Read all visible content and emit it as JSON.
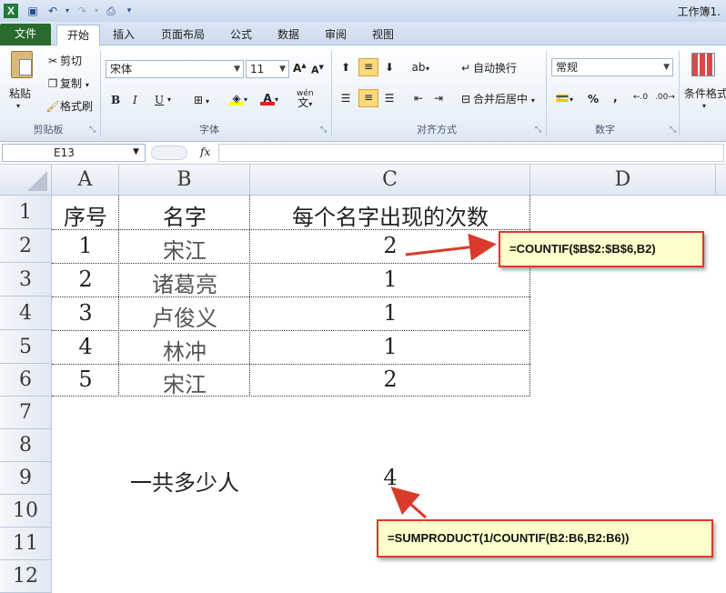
{
  "window": {
    "title": "工作簿1."
  },
  "quick_access": {
    "icons": [
      "excel-icon",
      "save-icon",
      "undo-icon",
      "redo-icon",
      "print-preview-icon",
      "customize-icon"
    ]
  },
  "tabs": [
    "文件",
    "开始",
    "插入",
    "页面布局",
    "公式",
    "数据",
    "审阅",
    "视图"
  ],
  "ribbon": {
    "clipboard": {
      "paste": "粘贴",
      "cut": "剪切",
      "copy": "复制",
      "format_painter": "格式刷",
      "label": "剪贴板"
    },
    "font": {
      "name": "宋体",
      "size": "11",
      "bold": "B",
      "italic": "I",
      "underline": "U",
      "label": "字体",
      "phonetic": "wén"
    },
    "alignment": {
      "wrap": "自动换行",
      "merge": "合并后居中",
      "label": "对齐方式"
    },
    "number": {
      "format": "常规",
      "percent": "%",
      "comma": ",",
      "label": "数字"
    },
    "styles": {
      "conditional": "条件格式"
    }
  },
  "formula_bar": {
    "name_box": "E13",
    "fx": "fx",
    "value": ""
  },
  "columns": [
    "A",
    "B",
    "C",
    "D"
  ],
  "rows": [
    "1",
    "2",
    "3",
    "4",
    "5",
    "6",
    "7",
    "8",
    "9",
    "10",
    "11",
    "12"
  ],
  "table": {
    "header": [
      "序号",
      "名字",
      "每个名字出现的次数"
    ],
    "rows": [
      [
        "1",
        "宋江",
        "2"
      ],
      [
        "2",
        "诸葛亮",
        "1"
      ],
      [
        "3",
        "卢俊义",
        "1"
      ],
      [
        "4",
        "林冲",
        "1"
      ],
      [
        "5",
        "宋江",
        "2"
      ]
    ]
  },
  "total": {
    "label": "一共多少人",
    "value": "4"
  },
  "annotations": {
    "countif": "=COUNTIF($B$2:$B$6,B2)",
    "sumproduct": "=SUMPRODUCT(1/COUNTIF(B2:B6,B2:B6))",
    "arrow_color": "#d93a2b"
  }
}
